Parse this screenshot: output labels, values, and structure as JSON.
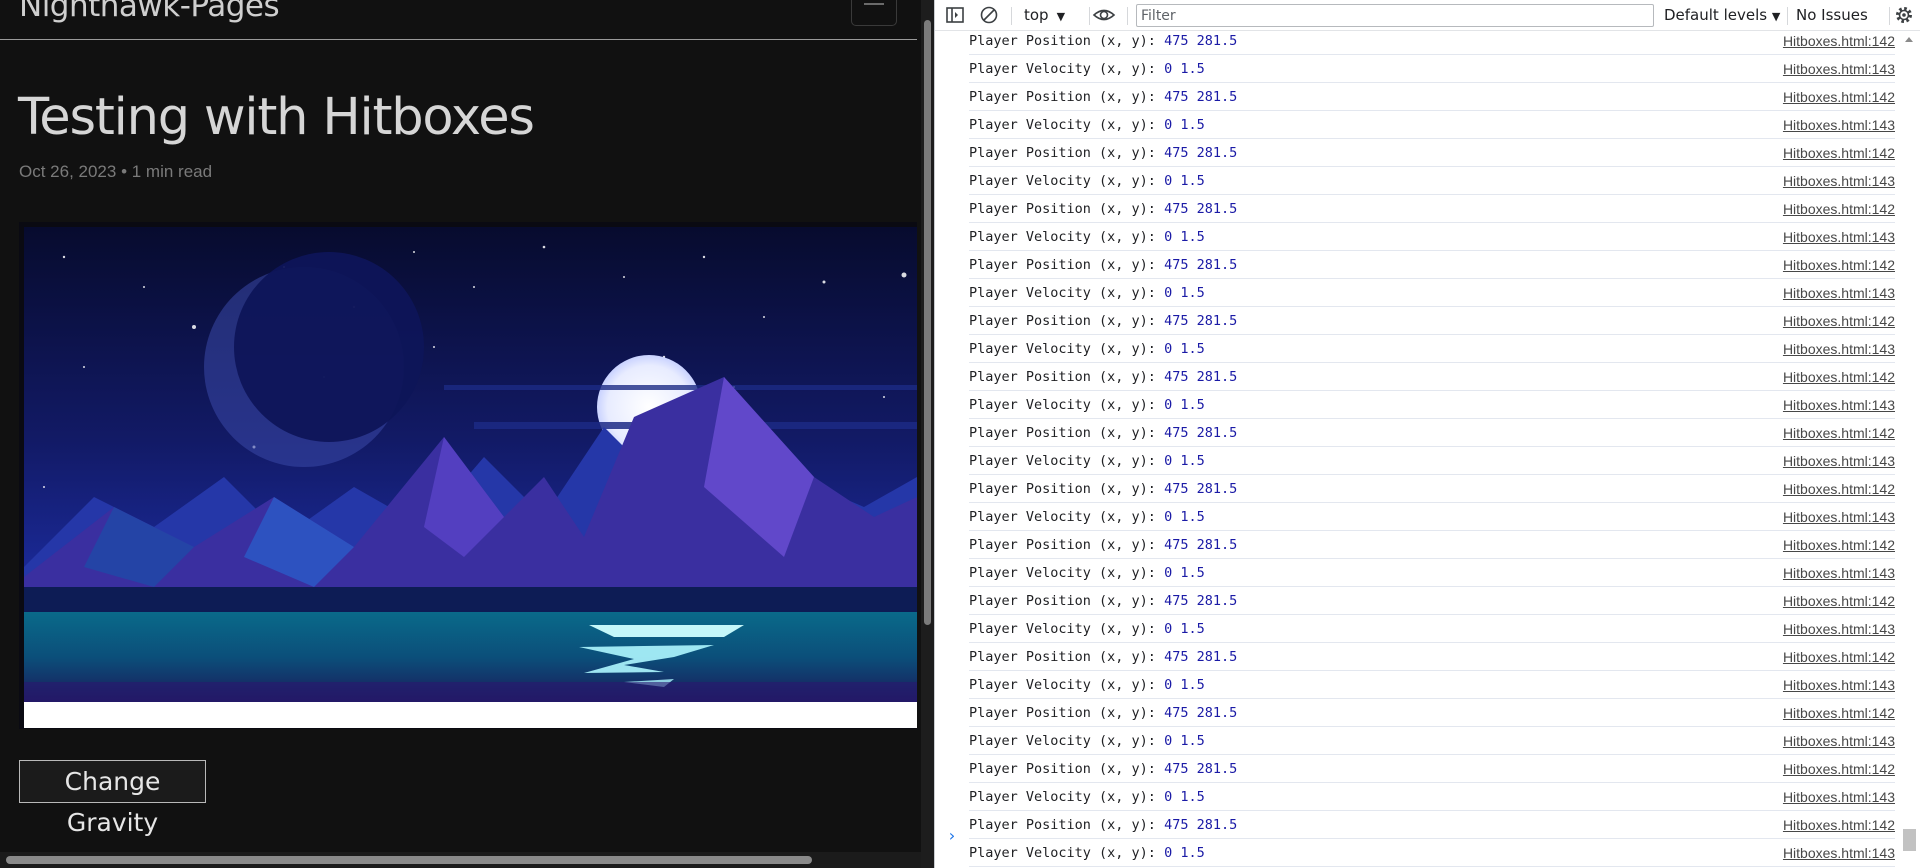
{
  "page": {
    "site_title": "Nighthawk-Pages",
    "post_title": "Testing with Hitboxes",
    "post_meta": "Oct 26, 2023 • 1 min read",
    "gravity_button": "Change Gravity"
  },
  "devtools": {
    "context": "top",
    "filter_placeholder": "Filter",
    "levels_label": "Default levels",
    "issues_label": "No Issues",
    "messages": [
      {
        "label": "Player Position (x, y):",
        "value": "475 281.5",
        "source": "Hitboxes.html:142"
      },
      {
        "label": "Player Velocity (x, y):",
        "value": "0 1.5",
        "source": "Hitboxes.html:143"
      },
      {
        "label": "Player Position (x, y):",
        "value": "475 281.5",
        "source": "Hitboxes.html:142"
      },
      {
        "label": "Player Velocity (x, y):",
        "value": "0 1.5",
        "source": "Hitboxes.html:143"
      },
      {
        "label": "Player Position (x, y):",
        "value": "475 281.5",
        "source": "Hitboxes.html:142"
      },
      {
        "label": "Player Velocity (x, y):",
        "value": "0 1.5",
        "source": "Hitboxes.html:143"
      },
      {
        "label": "Player Position (x, y):",
        "value": "475 281.5",
        "source": "Hitboxes.html:142"
      },
      {
        "label": "Player Velocity (x, y):",
        "value": "0 1.5",
        "source": "Hitboxes.html:143"
      },
      {
        "label": "Player Position (x, y):",
        "value": "475 281.5",
        "source": "Hitboxes.html:142"
      },
      {
        "label": "Player Velocity (x, y):",
        "value": "0 1.5",
        "source": "Hitboxes.html:143"
      },
      {
        "label": "Player Position (x, y):",
        "value": "475 281.5",
        "source": "Hitboxes.html:142"
      },
      {
        "label": "Player Velocity (x, y):",
        "value": "0 1.5",
        "source": "Hitboxes.html:143"
      },
      {
        "label": "Player Position (x, y):",
        "value": "475 281.5",
        "source": "Hitboxes.html:142"
      },
      {
        "label": "Player Velocity (x, y):",
        "value": "0 1.5",
        "source": "Hitboxes.html:143"
      },
      {
        "label": "Player Position (x, y):",
        "value": "475 281.5",
        "source": "Hitboxes.html:142"
      },
      {
        "label": "Player Velocity (x, y):",
        "value": "0 1.5",
        "source": "Hitboxes.html:143"
      },
      {
        "label": "Player Position (x, y):",
        "value": "475 281.5",
        "source": "Hitboxes.html:142"
      },
      {
        "label": "Player Velocity (x, y):",
        "value": "0 1.5",
        "source": "Hitboxes.html:143"
      },
      {
        "label": "Player Position (x, y):",
        "value": "475 281.5",
        "source": "Hitboxes.html:142"
      },
      {
        "label": "Player Velocity (x, y):",
        "value": "0 1.5",
        "source": "Hitboxes.html:143"
      },
      {
        "label": "Player Position (x, y):",
        "value": "475 281.5",
        "source": "Hitboxes.html:142"
      },
      {
        "label": "Player Velocity (x, y):",
        "value": "0 1.5",
        "source": "Hitboxes.html:143"
      },
      {
        "label": "Player Position (x, y):",
        "value": "475 281.5",
        "source": "Hitboxes.html:142"
      },
      {
        "label": "Player Velocity (x, y):",
        "value": "0 1.5",
        "source": "Hitboxes.html:143"
      },
      {
        "label": "Player Position (x, y):",
        "value": "475 281.5",
        "source": "Hitboxes.html:142"
      },
      {
        "label": "Player Velocity (x, y):",
        "value": "0 1.5",
        "source": "Hitboxes.html:143"
      },
      {
        "label": "Player Position (x, y):",
        "value": "475 281.5",
        "source": "Hitboxes.html:142"
      },
      {
        "label": "Player Velocity (x, y):",
        "value": "0 1.5",
        "source": "Hitboxes.html:143"
      },
      {
        "label": "Player Position (x, y):",
        "value": "475 281.5",
        "source": "Hitboxes.html:142"
      },
      {
        "label": "Player Velocity (x, y):",
        "value": "0 1.5",
        "source": "Hitboxes.html:143"
      }
    ],
    "icons": {
      "sidebar": "sidebar-toggle-icon",
      "clear": "clear-console-icon",
      "eye": "live-expression-eye-icon",
      "settings": "settings-gear-icon",
      "prompt": "console-prompt-chevron-icon"
    }
  }
}
